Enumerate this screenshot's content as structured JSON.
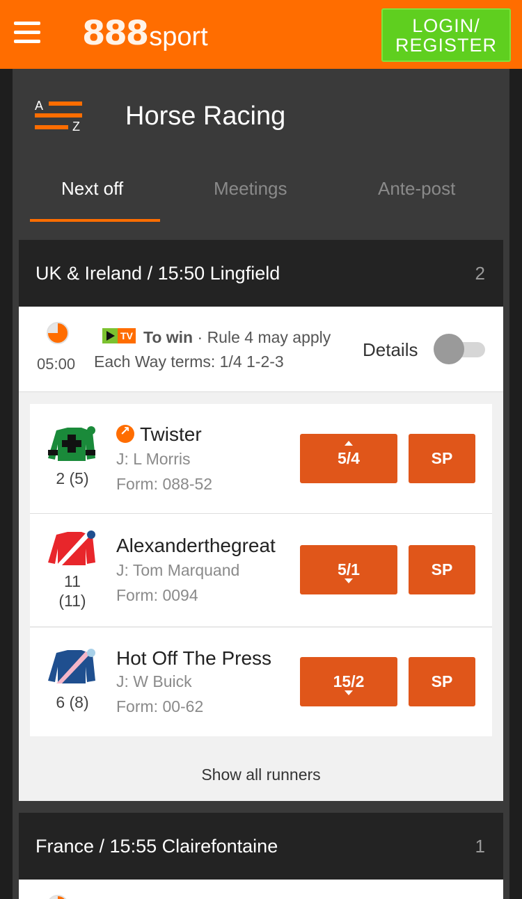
{
  "header": {
    "logo_number": "888",
    "logo_word": "sport",
    "login_line1": "LOGIN/",
    "login_line2": "REGISTER"
  },
  "page": {
    "az_a": "A",
    "az_z": "Z",
    "title": "Horse Racing"
  },
  "tabs": [
    {
      "label": "Next off",
      "active": true
    },
    {
      "label": "Meetings",
      "active": false
    },
    {
      "label": "Ante-post",
      "active": false
    }
  ],
  "races": [
    {
      "header": "UK & Ireland / 15:50 Lingfield",
      "count": "2",
      "countdown": "05:00",
      "tv_label": "TV",
      "to_win": "To win",
      "rule": "· Rule 4 may apply",
      "each_way": "Each Way terms: 1/4 1-2-3",
      "details_label": "Details",
      "runners": [
        {
          "name": "Twister",
          "jockey": "J: L Morris",
          "form": "Form: 088-52",
          "draw": "2 (5)",
          "odds": "5/4",
          "odds_trend": "up",
          "sp": "SP",
          "favourite": true,
          "silks_color": "#1a8a3a"
        },
        {
          "name": "Alexanderthegreat",
          "jockey": "J: Tom Marquand",
          "form": "Form: 0094",
          "draw_line1": "11",
          "draw_line2": "(11)",
          "odds": "5/1",
          "odds_trend": "down",
          "sp": "SP",
          "favourite": false,
          "silks_color": "#e8262b"
        },
        {
          "name": "Hot Off The Press",
          "jockey": "J: W Buick",
          "form": "Form: 00-62",
          "draw": "6 (8)",
          "odds": "15/2",
          "odds_trend": "down",
          "sp": "SP",
          "favourite": false,
          "silks_color": "#1f4f8f"
        }
      ],
      "show_all": "Show all runners"
    },
    {
      "header": "France / 15:55 Clairefontaine",
      "count": "1"
    }
  ],
  "colors": {
    "brand": "#ff6d00",
    "login_green": "#5fcf1f",
    "odds_button": "#e0561a",
    "dark_panel": "#3a3a3a",
    "race_header": "#232323"
  }
}
